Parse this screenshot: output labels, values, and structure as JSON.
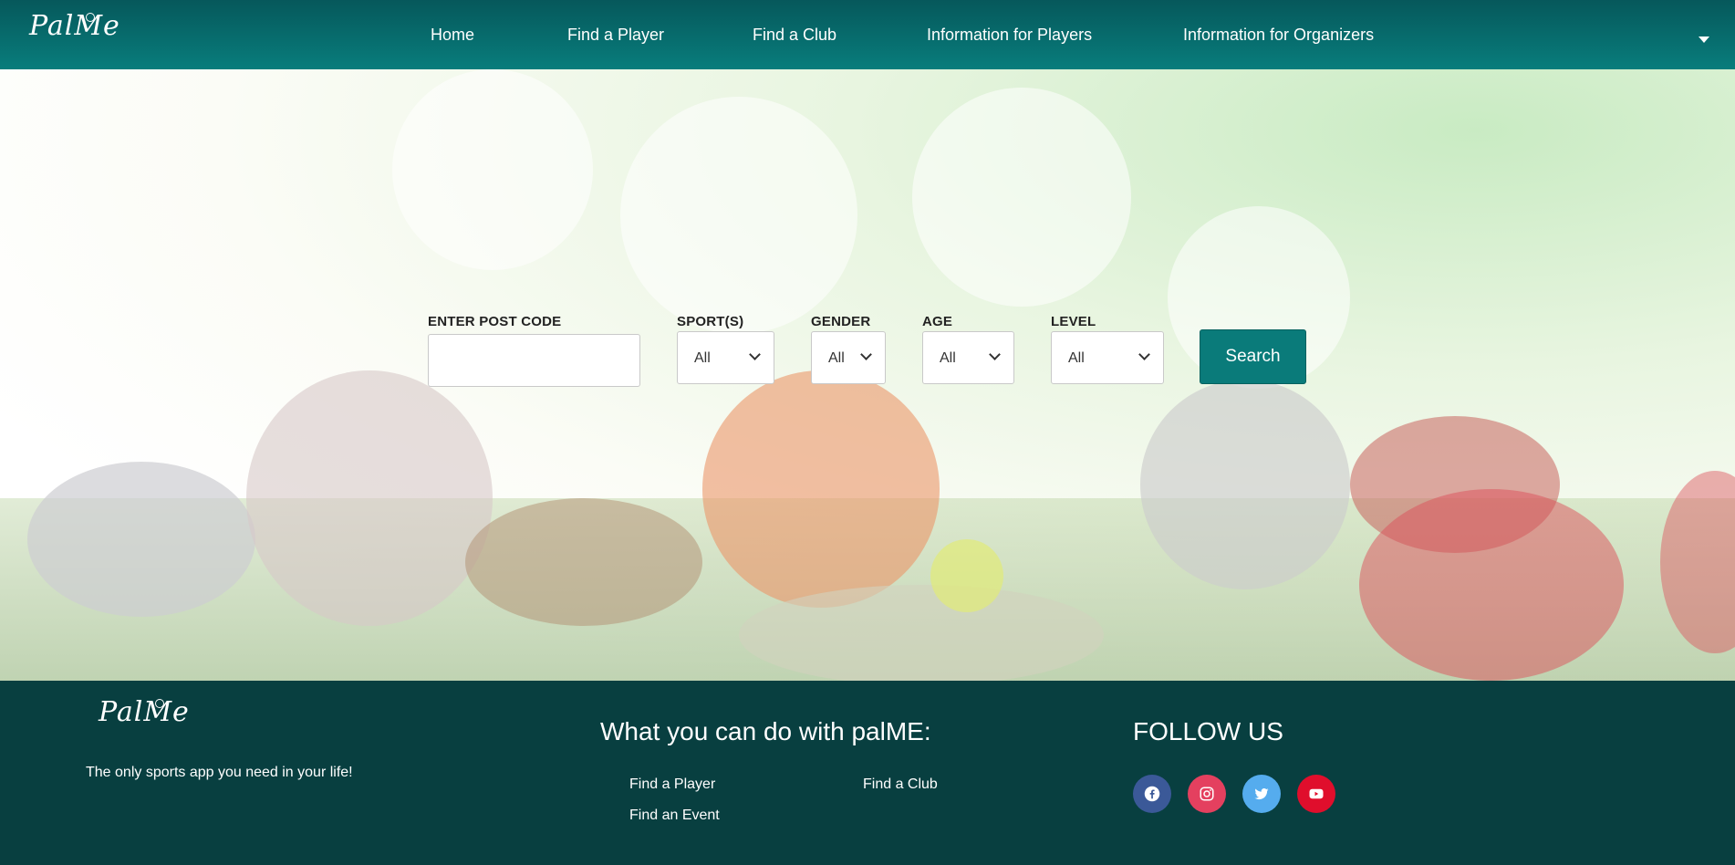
{
  "header": {
    "logo_text": "PalMe",
    "nav": [
      "Home",
      "Find a Player",
      "Find a Club",
      "Information for Players",
      "Information for Organizers"
    ]
  },
  "search": {
    "postcode_label": "ENTER POST CODE",
    "postcode_value": "",
    "filters": [
      {
        "label": "SPORT(S)",
        "value": "All"
      },
      {
        "label": "GENDER",
        "value": "All"
      },
      {
        "label": "AGE",
        "value": "All"
      },
      {
        "label": "LEVEL",
        "value": "All"
      }
    ],
    "button_label": "Search"
  },
  "footer": {
    "logo_text": "PalMe",
    "tagline": "The only sports app you need in your life!",
    "features_title": "What you can do with palME:",
    "features": [
      "Find a Player",
      "Find a Club",
      "Find an Event"
    ],
    "follow_title": "FOLLOW US",
    "social": [
      {
        "name": "facebook-icon",
        "color": "#3b5998"
      },
      {
        "name": "instagram-icon",
        "color": "#e4405f"
      },
      {
        "name": "twitter-icon",
        "color": "#55acee"
      },
      {
        "name": "youtube-icon",
        "color": "#e00e2c"
      }
    ]
  },
  "colors": {
    "header": "#087d7c",
    "footer": "#083f40",
    "accent": "#0a7b7a"
  }
}
